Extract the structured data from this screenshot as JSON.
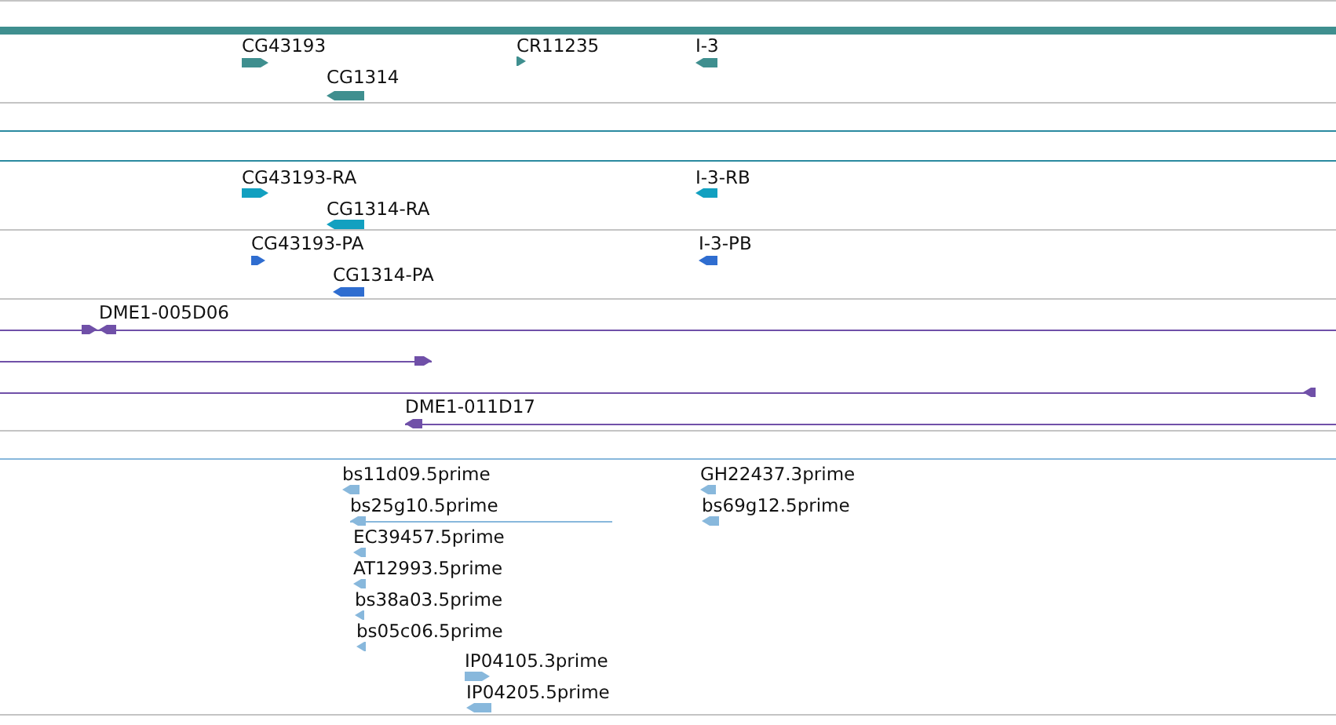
{
  "tracks": [
    {
      "color": "#3f8f8f",
      "features": [
        {
          "label": "CG43193",
          "reverse": false
        },
        {
          "label": "CR11235",
          "reverse": false
        },
        {
          "label": "I-3",
          "reverse": true
        },
        {
          "label": "CG1314",
          "reverse": true
        }
      ]
    },
    {
      "color": "#12a0c0",
      "features": [
        {
          "label": "CG43193-RA",
          "reverse": false
        },
        {
          "label": "I-3-RB",
          "reverse": true
        },
        {
          "label": "CG1314-RA",
          "reverse": true
        }
      ]
    },
    {
      "color": "#2f6dd0",
      "features": [
        {
          "label": "CG43193-PA",
          "reverse": false
        },
        {
          "label": "I-3-PB",
          "reverse": true
        },
        {
          "label": "CG1314-PA",
          "reverse": true
        }
      ]
    },
    {
      "color": "#7050a8",
      "features": [
        {
          "reverse": false
        },
        {
          "label": "DME1-005D06",
          "reverse": true
        },
        {
          "reverse": false
        },
        {
          "reverse": true
        },
        {
          "label": "DME1-011D17",
          "reverse": true
        }
      ]
    },
    {
      "color": "#88b8dc",
      "features": [
        {
          "label": "bs11d09.5prime",
          "reverse": true
        },
        {
          "label": "GH22437.3prime",
          "reverse": true
        },
        {
          "label": "bs25g10.5prime",
          "reverse": true
        },
        {
          "label": "bs69g12.5prime",
          "reverse": true
        },
        {
          "label": "EC39457.5prime",
          "reverse": true
        },
        {
          "label": "AT12993.5prime",
          "reverse": true
        },
        {
          "label": "bs38a03.5prime",
          "reverse": true
        },
        {
          "label": "bs05c06.5prime",
          "reverse": true
        },
        {
          "label": "IP04105.3prime",
          "reverse": false
        },
        {
          "label": "IP04205.5prime",
          "reverse": true
        }
      ]
    }
  ]
}
